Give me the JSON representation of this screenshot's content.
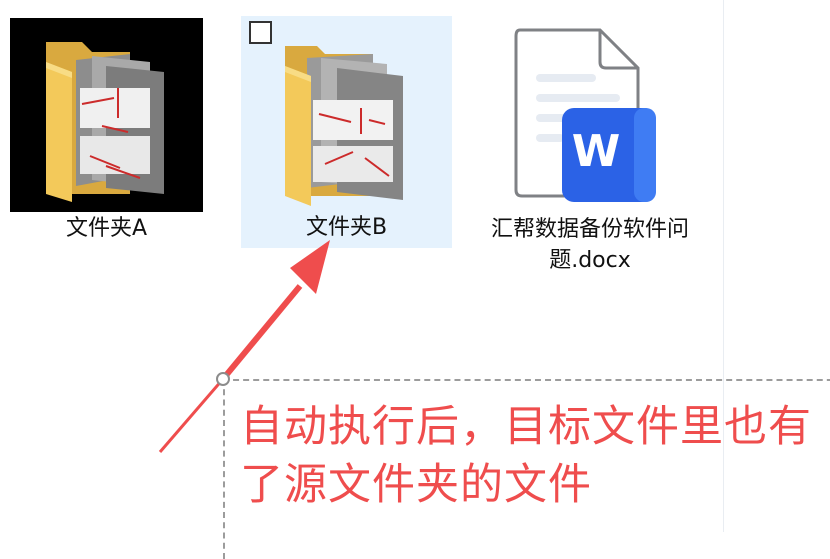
{
  "files": [
    {
      "name": "文件夹A",
      "type": "folder",
      "selected": false
    },
    {
      "name": "文件夹B",
      "type": "folder",
      "selected": true
    },
    {
      "name": "汇帮数据备份软件问题.docx",
      "type": "word-document",
      "selected": false
    }
  ],
  "annotation": {
    "text": "自动执行后，目标文件里也有了源文件夹的文件",
    "color": "#ef4d4d"
  },
  "colors": {
    "selection_background": "#e5f2fd",
    "folder_yellow": "#f3c95a",
    "word_blue": "#2b62e6"
  }
}
